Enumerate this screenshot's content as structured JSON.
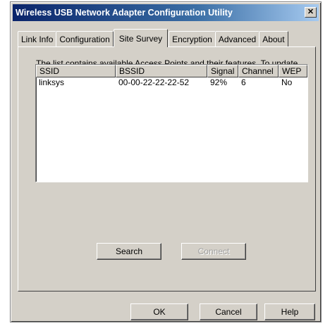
{
  "window": {
    "title": "Wireless USB Network Adapter Configuration Utility",
    "close_label": "✕"
  },
  "tabs": [
    {
      "label": "Link Info"
    },
    {
      "label": "Configuration"
    },
    {
      "label": "Site Survey"
    },
    {
      "label": "Encryption"
    },
    {
      "label": "Advanced"
    },
    {
      "label": "About"
    }
  ],
  "site_survey": {
    "description": "The list contains available Access Points and their features. To update the list, click 'Search' button. You can select a desired Access Point from the list, and click 'Connect' button to connect to the specified Access Point.",
    "columns": [
      "SSID",
      "BSSID",
      "Signal",
      "Channel",
      "WEP"
    ],
    "rows": [
      {
        "ssid": "linksys",
        "bssid": "00-00-22-22-22-52",
        "signal": "92%",
        "channel": "6",
        "wep": "No"
      }
    ],
    "search_label": "Search",
    "connect_label": "Connect"
  },
  "footer": {
    "ok_label": "OK",
    "cancel_label": "Cancel",
    "help_label": "Help"
  }
}
